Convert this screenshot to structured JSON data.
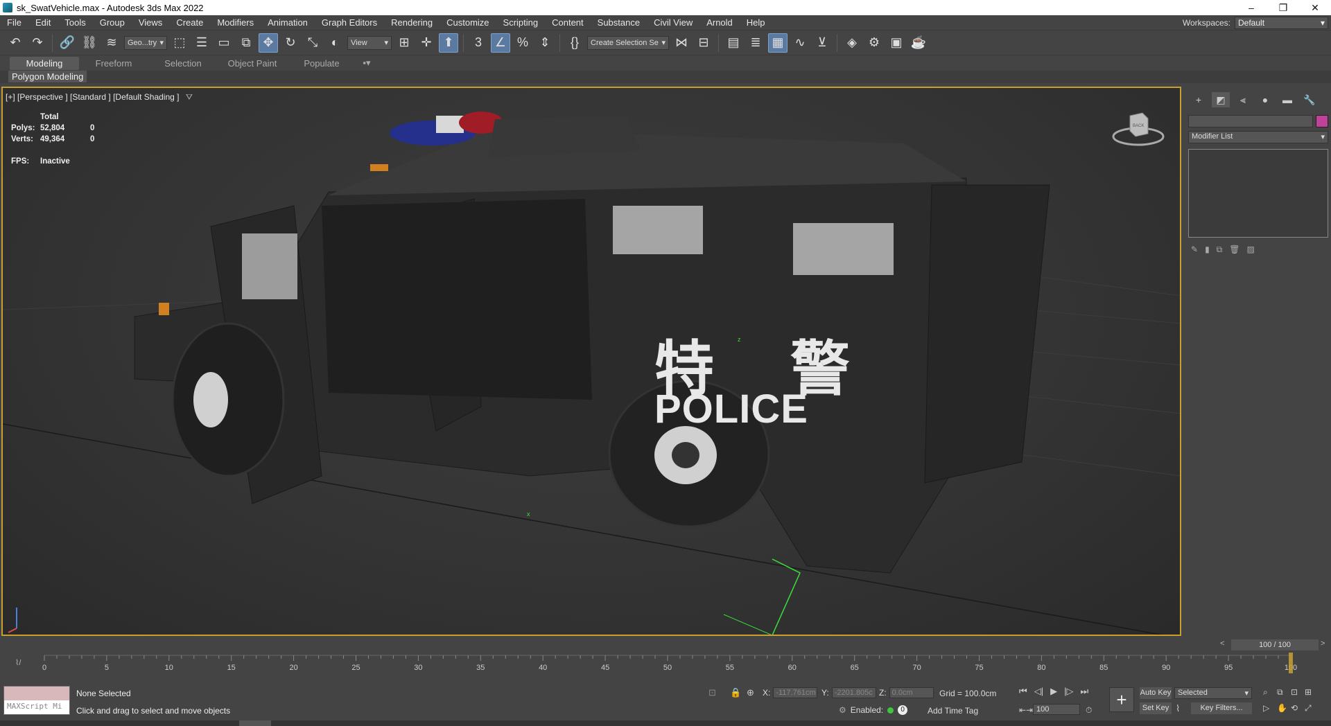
{
  "window": {
    "title": "sk_SwatVehicle.max - Autodesk 3ds Max 2022",
    "controls": [
      "–",
      "❐",
      "✕"
    ]
  },
  "menu": [
    "File",
    "Edit",
    "Tools",
    "Group",
    "Views",
    "Create",
    "Modifiers",
    "Animation",
    "Graph Editors",
    "Rendering",
    "Customize",
    "Scripting",
    "Content",
    "Substance",
    "Civil View",
    "Arnold",
    "Help"
  ],
  "workspaces": {
    "label": "Workspaces:",
    "value": "Default"
  },
  "toolbar": {
    "selection_filter": "Geo...try",
    "ref_coord": "View",
    "named_selection": "Create Selection Se",
    "icons": [
      "undo-icon",
      "redo-icon",
      "link-icon",
      "unlink-icon",
      "bind-space-warp-icon",
      "select-object-icon",
      "select-by-name-icon",
      "rect-region-icon",
      "window-crossing-icon",
      "select-move-icon",
      "select-rotate-icon",
      "select-scale-icon",
      "placement-icon",
      "snaps-icon",
      "angle-snap-icon",
      "percent-snap-icon",
      "spinner-snap-icon",
      "edit-named-sel-icon",
      "mirror-icon",
      "align-icon",
      "scene-explorer-icon",
      "layer-explorer-icon",
      "toggle-ribbon-icon",
      "curve-editor-icon",
      "schematic-view-icon",
      "material-editor-icon",
      "render-setup-icon",
      "rendered-frame-icon",
      "render-icon"
    ]
  },
  "ribbon": {
    "tabs": [
      "Modeling",
      "Freeform",
      "Selection",
      "Object Paint",
      "Populate"
    ],
    "active_tab": "Modeling",
    "sub_panel": "Polygon Modeling"
  },
  "viewport": {
    "label": "[+] [Perspective ] [Standard ] [Default Shading ]",
    "stats": {
      "header": "Total",
      "polys_label": "Polys:",
      "polys_total": "52,804",
      "polys_sel": "0",
      "verts_label": "Verts:",
      "verts_total": "49,364",
      "verts_sel": "0",
      "fps_label": "FPS:",
      "fps_value": "Inactive"
    },
    "vehicle_text_cn": "特 警",
    "vehicle_text_en": "POLICE",
    "viewcube_label": "BACK",
    "z_axis_mark": "z",
    "x_axis_mark": "x"
  },
  "command_panel": {
    "modifier_list": "Modifier List",
    "object_color": "#c0419a"
  },
  "time_slider": {
    "frame": "100 / 100"
  },
  "trackbar": {
    "ticks": [
      "0",
      "5",
      "10",
      "15",
      "20",
      "25",
      "30",
      "35",
      "40",
      "45",
      "50",
      "55",
      "60",
      "65",
      "70",
      "75",
      "80",
      "85",
      "90",
      "95",
      "100"
    ]
  },
  "status": {
    "maxscript": "MAXScript Mi",
    "selection": "None Selected",
    "prompt": "Click and drag to select and move objects",
    "x_label": "X:",
    "x_value": "-117.761cm",
    "y_label": "Y:",
    "y_value": "-2201.805c",
    "z_label": "Z:",
    "z_value": "0.0cm",
    "grid": "Grid = 100.0cm",
    "enabled_label": "Enabled:",
    "enabled_num": "0",
    "add_time_tag": "Add Time Tag",
    "frame_spinner": "100",
    "auto_key": "Auto Key",
    "set_key": "Set Key",
    "selected_dd": "Selected",
    "key_filters": "Key Filters..."
  }
}
